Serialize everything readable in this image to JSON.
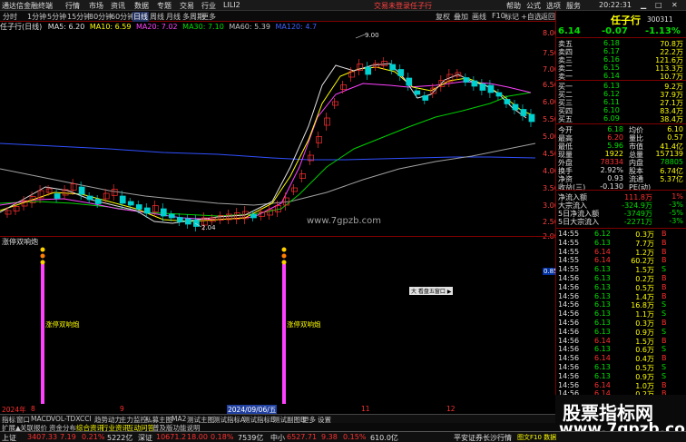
{
  "menubar": {
    "app": "通达信金融终端",
    "items": [
      "行情",
      "市场",
      "资讯",
      "数据",
      "专题",
      "交易",
      "行业",
      "LILI2"
    ],
    "not_logged": "交易未登录",
    "stock": "任子行",
    "right": [
      "帮助",
      "公式",
      "选项",
      "服务"
    ]
  },
  "toolbar": {
    "periods": [
      "分时",
      "1分钟",
      "5分钟",
      "15分钟",
      "30分钟",
      "60分钟",
      "日线",
      "周线",
      "月线",
      "多周期",
      "更多"
    ],
    "right": [
      "复权",
      "叠加",
      "画线",
      "F10",
      "标记",
      "+自选",
      "返回"
    ]
  },
  "chart": {
    "title_name": "任子行(日线)",
    "ma5": "MA5: 6.20",
    "ma10": "MA10: 6.59",
    "ma20": "MA20: 7.02",
    "ma30": "MA30: 7.10",
    "ma60": "MA60: 5.39",
    "ma120": "MA120: 4.7",
    "high_label": "9.00",
    "low_label": "2.04",
    "y_ticks": [
      "8.00",
      "7.50",
      "7.00",
      "6.50",
      "6.00",
      "5.50",
      "5.00",
      "4.50",
      "4.00",
      "3.50",
      "3.00",
      "2.50",
      "2.00"
    ],
    "x_ticks": [
      "2024年",
      "8",
      "9",
      "10",
      "11",
      "12"
    ],
    "x_highlight": "2024/09/06/五",
    "watermark": "www.7gpzb.com",
    "ind_title": "涨停双响炮",
    "ind_label": "涨停双响炮",
    "ind_value": "0.85",
    "mini_box": "大 看盘五窗口 ▶"
  },
  "tabs": {
    "row1": [
      "指标",
      "窗口",
      "MACD",
      "VOL-TDX",
      "CCI",
      "趋势动力",
      "主力监控",
      "私募主图",
      "MA2",
      "测试主图",
      "测试指标A",
      "测试指标B",
      "测试副图B",
      "更多",
      "设置"
    ],
    "row2": [
      "扩展▲",
      "关联报价",
      "资金分布",
      "综合资讯",
      "行业资讯",
      "互动问答",
      "普及版功能说明"
    ]
  },
  "quote": {
    "name": "任子行",
    "code": "300311",
    "price": "6.14",
    "change": "-0.07",
    "pct": "-1.13%",
    "asks": [
      {
        "label": "卖五",
        "price": "6.18",
        "vol": "70.8万"
      },
      {
        "label": "卖四",
        "price": "6.17",
        "vol": "22.2万"
      },
      {
        "label": "卖三",
        "price": "6.16",
        "vol": "121.6万"
      },
      {
        "label": "卖二",
        "price": "6.15",
        "vol": "113.3万"
      },
      {
        "label": "卖一",
        "price": "6.14",
        "vol": "10.7万"
      }
    ],
    "bids": [
      {
        "label": "买一",
        "price": "6.13",
        "vol": "9.2万"
      },
      {
        "label": "买二",
        "price": "6.12",
        "vol": "37.9万"
      },
      {
        "label": "买三",
        "price": "6.11",
        "vol": "27.1万"
      },
      {
        "label": "买四",
        "price": "6.10",
        "vol": "83.4万"
      },
      {
        "label": "买五",
        "price": "6.09",
        "vol": "38.4万"
      }
    ],
    "stats": [
      {
        "l1": "今开",
        "v1": "6.18",
        "l2": "均价",
        "v2": "6.10"
      },
      {
        "l1": "最高",
        "v1": "6.20",
        "l2": "量比",
        "v2": "0.57"
      },
      {
        "l1": "最低",
        "v1": "5.96",
        "l2": "市值",
        "v2": "41.4亿"
      },
      {
        "l1": "现量",
        "v1": "1922",
        "l2": "总量",
        "v2": "157139"
      },
      {
        "l1": "外盘",
        "v1": "78334",
        "l2": "内盘",
        "v2": "78805"
      },
      {
        "l1": "换手",
        "v1": "2.92%",
        "l2": "股本",
        "v2": "6.74亿"
      },
      {
        "l1": "净资",
        "v1": "0.93",
        "l2": "流通",
        "v2": "5.37亿"
      },
      {
        "l1": "收益(三)",
        "v1": "-0.130",
        "l2": "PE(动)",
        "v2": ""
      }
    ],
    "flows": [
      {
        "label": "净流入额",
        "value": "111.8万",
        "pct": "1%"
      },
      {
        "label": "大宗流入",
        "value": "-324.9万",
        "pct": "-3%"
      },
      {
        "label": "5日净流入额",
        "value": "-3749万",
        "pct": "-5%"
      },
      {
        "label": "5日大宗流入",
        "value": "-2271万",
        "pct": "-3%"
      }
    ],
    "ticks": [
      {
        "t": "14:55",
        "p": "6.12",
        "v": "0.3万",
        "s": "B"
      },
      {
        "t": "14:55",
        "p": "6.13",
        "v": "7.7万",
        "s": "B"
      },
      {
        "t": "14:55",
        "p": "6.14",
        "v": "1.2万",
        "s": "B"
      },
      {
        "t": "14:55",
        "p": "6.14",
        "v": "60.2万",
        "s": "B"
      },
      {
        "t": "14:55",
        "p": "6.13",
        "v": "1.5万",
        "s": "S"
      },
      {
        "t": "14:56",
        "p": "6.13",
        "v": "0.2万",
        "s": "B"
      },
      {
        "t": "14:56",
        "p": "6.13",
        "v": "0.5万",
        "s": "B"
      },
      {
        "t": "14:56",
        "p": "6.13",
        "v": "1.4万",
        "s": "B"
      },
      {
        "t": "14:56",
        "p": "6.13",
        "v": "16.8万",
        "s": "S"
      },
      {
        "t": "14:56",
        "p": "6.13",
        "v": "1.1万",
        "s": "S"
      },
      {
        "t": "14:56",
        "p": "6.13",
        "v": "0.3万",
        "s": "B"
      },
      {
        "t": "14:56",
        "p": "6.13",
        "v": "0.9万",
        "s": "S"
      },
      {
        "t": "14:56",
        "p": "6.14",
        "v": "1.5万",
        "s": "B"
      },
      {
        "t": "14:56",
        "p": "6.13",
        "v": "0.6万",
        "s": "S"
      },
      {
        "t": "14:56",
        "p": "6.14",
        "v": "0.4万",
        "s": "B"
      },
      {
        "t": "14:56",
        "p": "6.13",
        "v": "0.5万",
        "s": "S"
      },
      {
        "t": "14:56",
        "p": "6.13",
        "v": "0.9万",
        "s": "S"
      },
      {
        "t": "14:56",
        "p": "6.14",
        "v": "1.0万",
        "s": "B"
      },
      {
        "t": "14:56",
        "p": "6.14",
        "v": "0.2万",
        "s": "B"
      },
      {
        "t": "14:56",
        "p": "6.14",
        "v": "17.1万",
        "s": "B"
      },
      {
        "t": "14:56",
        "p": "6.13",
        "v": "2.3万",
        "s": "S"
      },
      {
        "t": "15:00",
        "p": "6.14",
        "v": "67.8万",
        "s": "B"
      }
    ]
  },
  "status": {
    "sh_label": "上证",
    "sh_value": "3407.33",
    "sh_chg": "7.19",
    "sh_pct": "0.21%",
    "sh_amt": "5222亿",
    "sz_label": "深证",
    "sz_value": "10671.2",
    "sz_chg": "18.00",
    "sz_pct": "0.18%",
    "sz_amt": "7539亿",
    "cy_label": "中小",
    "cy_value": "6527.71",
    "cy_chg": "9.38",
    "cy_pct": "0.15%",
    "cy_amt": "610.0亿",
    "broker": "平安证券长沙行情",
    "f10": "图文F10 数据"
  },
  "brand": {
    "line1": "股票指标网",
    "line2": "www.7gpzb.com"
  },
  "time": "20:22:31"
}
